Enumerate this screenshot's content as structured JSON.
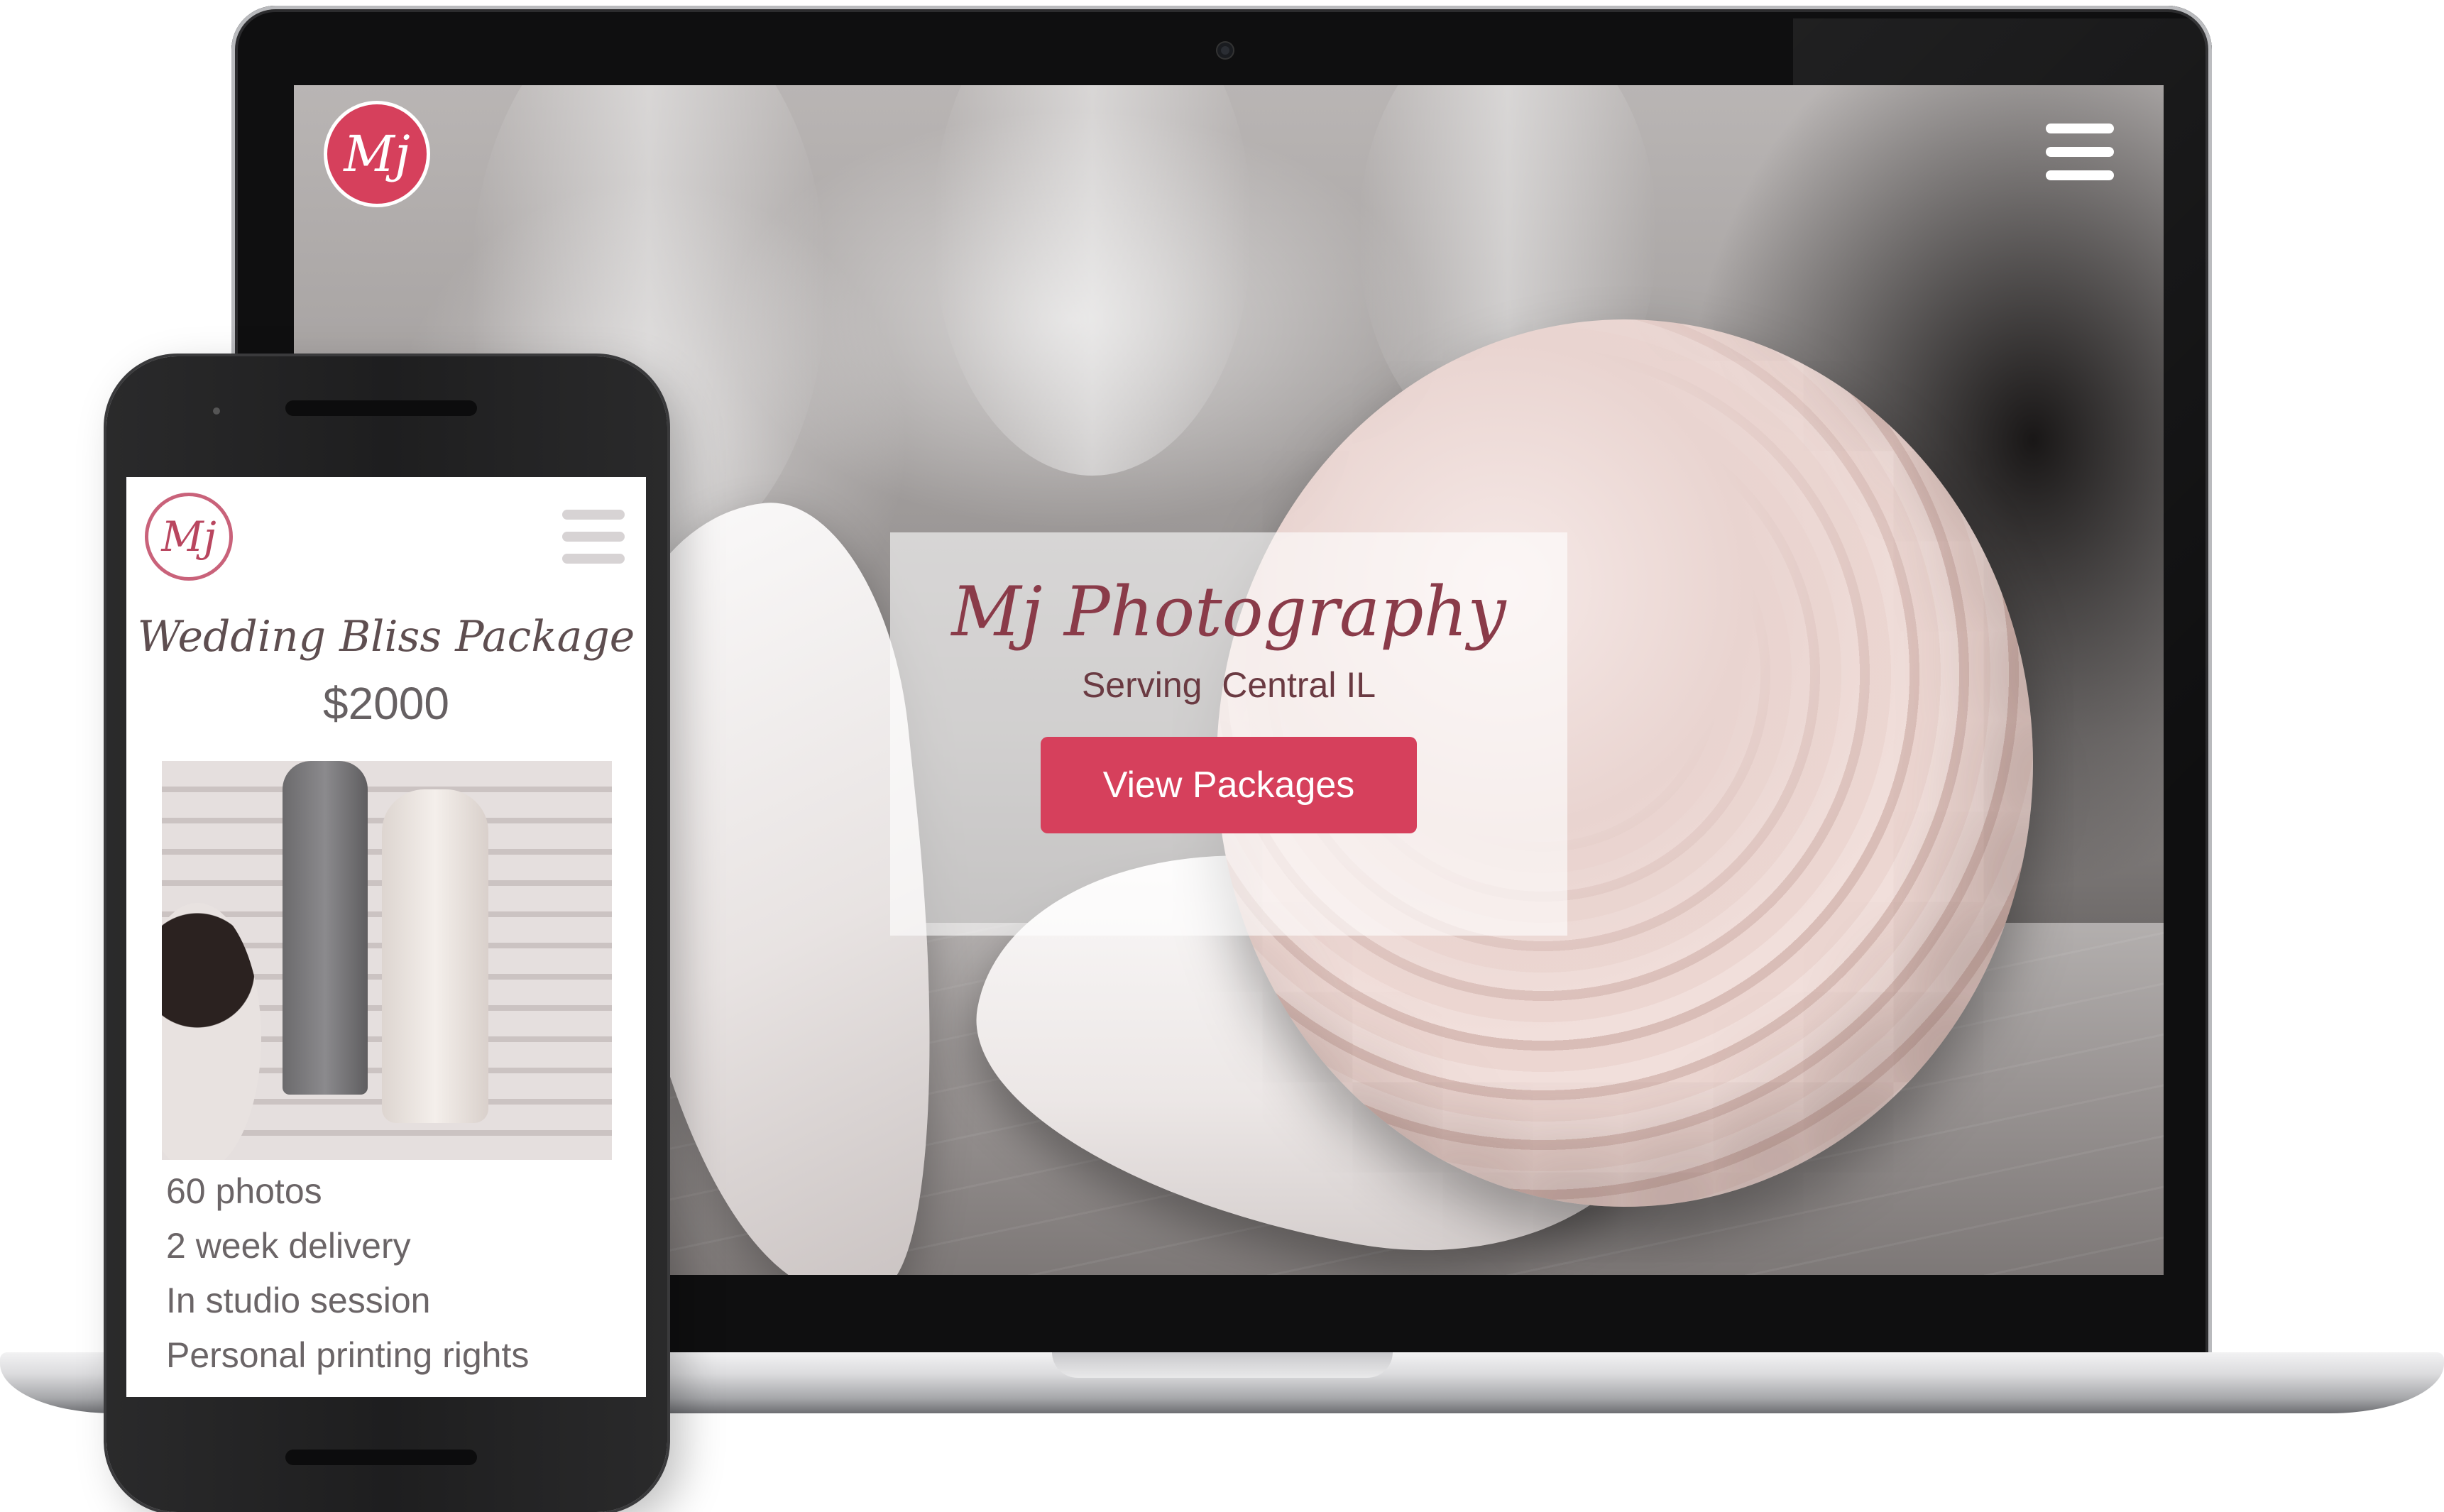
{
  "desktop": {
    "logo_text": "Mj",
    "hero": {
      "title": "Mj Photography",
      "subtitle": "Serving  Central IL",
      "button_label": "View Packages"
    }
  },
  "mobile": {
    "logo_text": "Mj",
    "package": {
      "title": "Wedding Bliss Package",
      "price": "$2000",
      "features": [
        "60 photos",
        "2 week delivery",
        "In studio session",
        "Personal printing rights"
      ]
    }
  },
  "colors": {
    "accent": "#d6405c",
    "title_text": "#8a3b49",
    "phone_body": "#1e1e1f",
    "laptop_frame": "#0f0f10"
  },
  "icons": [
    "hamburger-menu-icon"
  ]
}
